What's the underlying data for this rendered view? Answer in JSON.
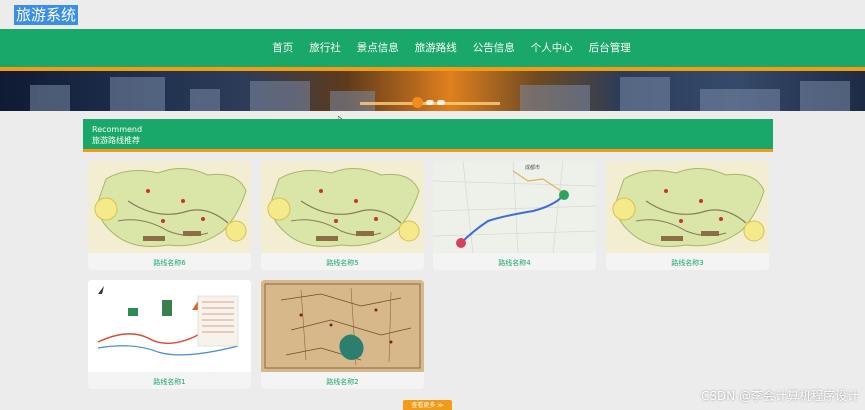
{
  "header": {
    "site_title": "旅游系统"
  },
  "nav": {
    "items": [
      "首页",
      "旅行社",
      "景点信息",
      "旅游路线",
      "公告信息",
      "个人中心",
      "后台管理"
    ]
  },
  "section": {
    "title_en": "Recommend",
    "title_cn": "旅游路线推荐"
  },
  "routes": [
    {
      "name": "路线名称6",
      "map": "yunnan-map"
    },
    {
      "name": "路线名称5",
      "map": "yunnan-map"
    },
    {
      "name": "路线名称4",
      "map": "sichuan-road-map"
    },
    {
      "name": "路线名称3",
      "map": "yunnan-map"
    },
    {
      "name": "路线名称1",
      "map": "scenic-route-diagram"
    },
    {
      "name": "路线名称2",
      "map": "ancient-parchment-map"
    }
  ],
  "more_button": "查看更多 ≫",
  "watermark": "CSDN @李会计算机程序设计",
  "colors": {
    "green": "#1aa86a",
    "orange": "#f39a16",
    "title_bg": "#3a8ee6"
  }
}
